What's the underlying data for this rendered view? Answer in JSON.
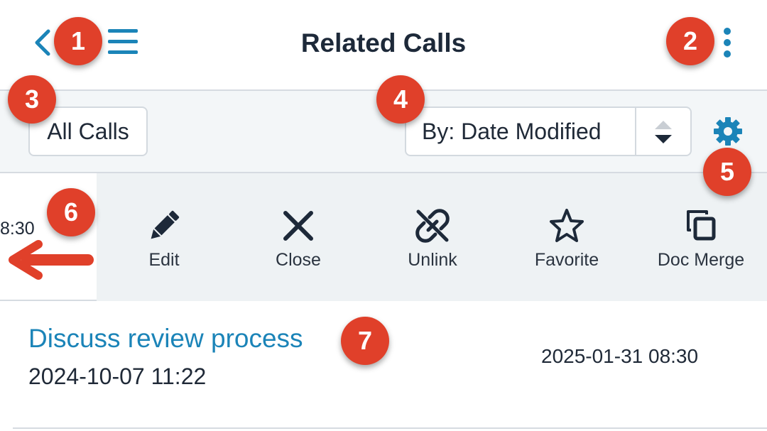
{
  "header": {
    "title": "Related Calls",
    "back_icon": "chevron-left-icon",
    "menu_icon": "hamburger-icon",
    "more_icon": "kebab-vertical-icon"
  },
  "filter": {
    "list_label": "All Calls",
    "sort_label": "By: Date Modified",
    "sort_icon": "sort-up-down-icon",
    "settings_icon": "gear-icon"
  },
  "swipe_row": {
    "partial_time": "8:30",
    "actions": [
      {
        "label": "Edit",
        "icon": "pencil-icon"
      },
      {
        "label": "Close",
        "icon": "x-icon"
      },
      {
        "label": "Unlink",
        "icon": "unlink-icon"
      },
      {
        "label": "Favorite",
        "icon": "star-icon"
      },
      {
        "label": "Doc Merge",
        "icon": "copy-icon"
      }
    ]
  },
  "record": {
    "title": "Discuss review process",
    "date_start": "2024-10-07 11:22",
    "date_modified": "2025-01-31 08:30"
  },
  "callouts": [
    "1",
    "2",
    "3",
    "4",
    "5",
    "6",
    "7"
  ],
  "colors": {
    "accent": "#1b84b8",
    "callout": "#e0402a",
    "text": "#1f2937",
    "bar_bg": "#f3f6f8"
  }
}
